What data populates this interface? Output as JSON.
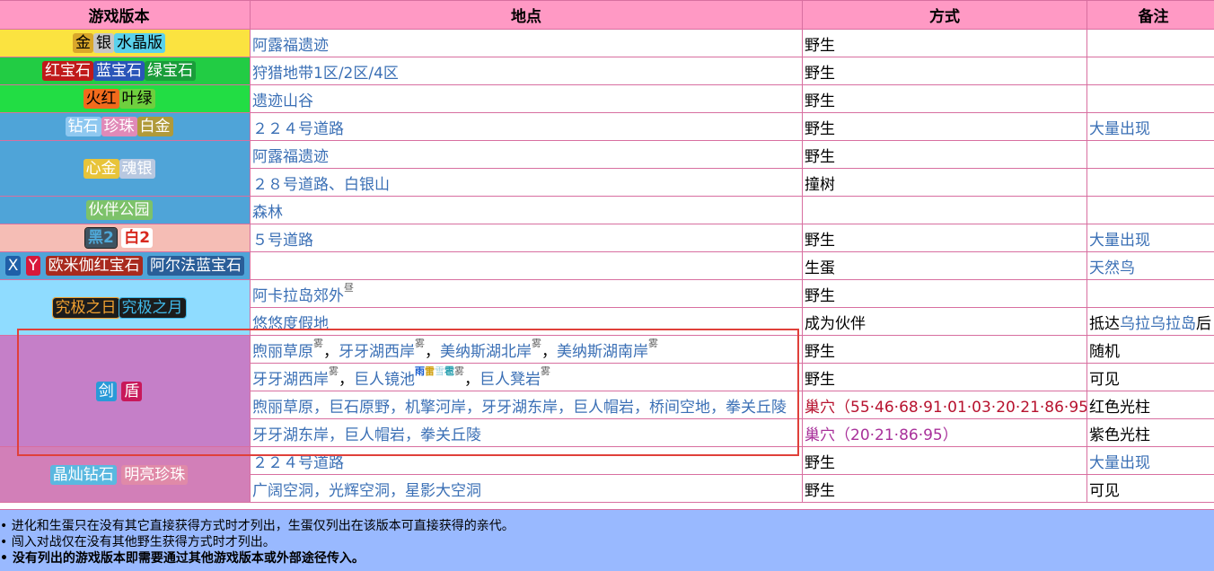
{
  "header": {
    "version": "游戏版本",
    "location": "地点",
    "method": "方式",
    "note": "备注"
  },
  "rows": {
    "gsc": {
      "tags": [
        "金",
        "银",
        "水晶版"
      ],
      "location": "阿露福遗迹",
      "method": "野生",
      "note": ""
    },
    "rse": {
      "tags": [
        "红宝石",
        "蓝宝石",
        "绿宝石"
      ],
      "location": "狩猎地带1区/2区/4区",
      "method": "野生",
      "note": ""
    },
    "frlg": {
      "tags": [
        "火红",
        "叶绿"
      ],
      "location": "遗迹山谷",
      "method": "野生",
      "note": ""
    },
    "dppt": {
      "tags": [
        "钻石",
        "珍珠",
        "白金"
      ],
      "location": "２２４号道路",
      "method": "野生",
      "note": "大量出现"
    },
    "hgss": {
      "tags": [
        "心金",
        "魂银"
      ],
      "rows": [
        {
          "location": "阿露福遗迹",
          "method": "野生",
          "note": ""
        },
        {
          "location": "２８号道路、白银山",
          "method": "撞树",
          "note": ""
        }
      ]
    },
    "pw": {
      "tags": [
        "伙伴公园"
      ],
      "location": "森林",
      "method": "",
      "note": ""
    },
    "b2w2": {
      "tags": [
        "黑2",
        "白2"
      ],
      "location": "５号道路",
      "method": "野生",
      "note": "大量出现"
    },
    "xyoras": {
      "tags": [
        "X",
        "Y",
        "欧米伽红宝石",
        "阿尔法蓝宝石"
      ],
      "location": "",
      "method": "生蛋",
      "note": "天然鸟"
    },
    "usum": {
      "tags": [
        "究极之日",
        "究极之月"
      ],
      "rows": [
        {
          "location": "阿卡拉岛郊外",
          "sup": "昼",
          "method": "野生",
          "note": ""
        },
        {
          "location": "悠悠度假地",
          "method": "成为伙伴",
          "note_prefix": "抵达",
          "note_link": "乌拉乌拉岛",
          "note_suffix": "后"
        }
      ]
    },
    "swsh": {
      "tags": [
        "剑",
        "盾"
      ],
      "rows": [
        {
          "locs": [
            "煦丽草原",
            "牙牙湖西岸",
            "美纳斯湖北岸",
            "美纳斯湖南岸"
          ],
          "sup": "雾",
          "method": "野生",
          "note": "随机"
        },
        {
          "loc1": "牙牙湖西岸",
          "sup1": "雾",
          "loc2": "巨人镜池",
          "w1": "雨",
          "w2": "雷",
          "w3": "雪",
          "w4": "雹",
          "w5": "雾",
          "loc3": "巨人凳岩",
          "sup3": "雾",
          "method": "野生",
          "note": "可见"
        },
        {
          "location": "煦丽草原，巨石原野，机擎河岸，牙牙湖东岸，巨人帽岩，桥间空地，拳关丘陵",
          "method_link": "巢穴",
          "method_detail": "（55·46·68·91·01·03·20·21·86·95）",
          "note": "红色光柱"
        },
        {
          "location": "牙牙湖东岸，巨人帽岩，拳关丘陵",
          "method_link": "巢穴",
          "method_detail": "（20·21·86·95）",
          "note": "紫色光柱"
        }
      ]
    },
    "bdsp": {
      "tags": [
        "晶灿钻石",
        "明亮珍珠"
      ],
      "rows": [
        {
          "location": "２２４号道路",
          "method": "野生",
          "note": "大量出现"
        },
        {
          "location": "广阔空洞，光辉空洞，星影大空洞",
          "method": "野生",
          "note": "可见"
        }
      ]
    }
  },
  "footnotes": [
    "• 进化和生蛋只在没有其它直接获得方式时才列出，生蛋仅列出在该版本可直接获得的亲代。",
    "• 闯入对战仅在没有其他野生获得方式时才列出。",
    "• 没有列出的游戏版本即需要通过其他游戏版本或外部途径传入。"
  ],
  "colors": {
    "header_bg": "#ff99c4",
    "gsc_bg": "#fbe340",
    "rse_bg": "#22cc44",
    "frlg_bg": "#22dd44",
    "dppt_bg": "#4fa4d8",
    "pw_bg": "#9acbe0",
    "b2w2_bg": "#f5bdb5",
    "usum_bg": "#8fdcff",
    "swsh_bg": "#c57fc8",
    "bdsp_bg": "#d27fb8",
    "footer_bg": "#99b9ff",
    "highlight_border": "#e0403a",
    "link": "#3a6fb5",
    "nest": "#b7122e"
  }
}
